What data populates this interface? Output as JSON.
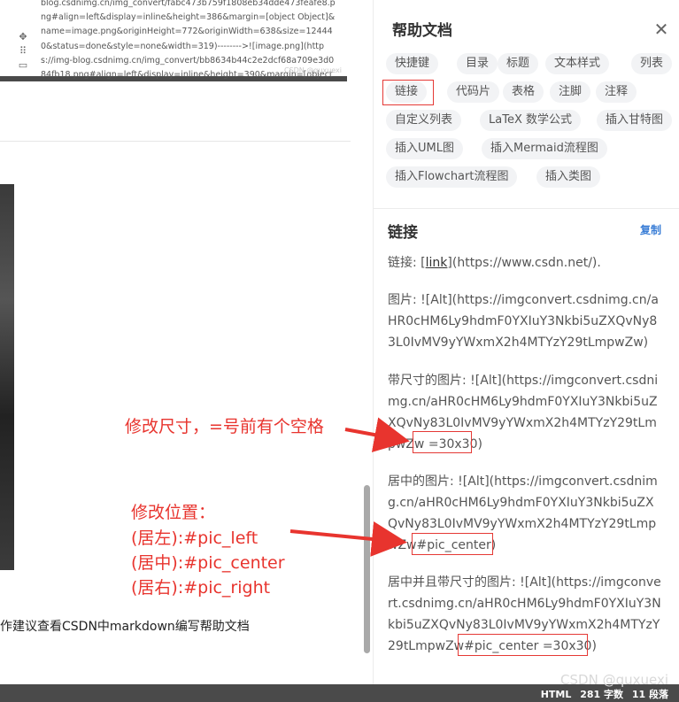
{
  "editor": {
    "code_lines": "blog.csdnimg.cn/img_convert/fabc473b759f1808eb34dde473feafe8.png#align=left&display=inline&height=386&margin=[object Object]&name=image.png&originHeight=772&originWidth=638&size=124440&status=done&style=none&width=319)-------->![image.png](https://img-blog.csdnimg.cn/img_convert/bb8634b44c2e2dcf68a709e3d084fb18.png#align=left&display=inline&height=390&margin=[object",
    "code_watermark": "CSDN @quxuexi",
    "bottom_text": "作建议查看CSDN中markdown编写帮助文档"
  },
  "annotations": {
    "size_note": "修改尺寸，=号前有个空格",
    "position_note_title": "修改位置：",
    "position_left": "(居左):#pic_left",
    "position_center": "(居中):#pic_center",
    "position_right": "(居右):#pic_right",
    "color": "#e8342e"
  },
  "help_panel": {
    "title": "帮助文档",
    "close_icon": "close-icon",
    "tags": [
      "快捷键",
      "目录",
      "标题",
      "文本样式",
      "列表",
      "链接",
      "代码片",
      "表格",
      "注脚",
      "注释",
      "自定义列表",
      "LaTeX 数学公式",
      "插入甘特图",
      "插入UML图",
      "插入Mermaid流程图",
      "插入Flowchart流程图",
      "插入类图"
    ],
    "active_tag": "链接",
    "section_title": "链接",
    "copy_label": "复制",
    "link_prefix": "链接: [",
    "link_text": "link",
    "link_suffix": "](https://www.csdn.net/).",
    "image_line": "图片: ![Alt](https://imgconvert.csdnimg.cn/aHR0cHM6Ly9hdmF0YXIuY3Nkbi5uZXQvNy83L0IvMV9yYWxmX2h4MTYzY29tLmpwZw)",
    "sized_prefix": "带尺寸的图片: ![Alt](https://imgconvert.csdnimg.cn/aHR0cHM6Ly9hdmF0YXIuY3Nkbi5uZXQvNy83L0IvMV9yYWxmX2h4MTYzY29tLmpwZw",
    "sized_suffix": " =30x30)",
    "center_prefix": "居中的图片: ![Alt](https://imgconvert.csdnimg.cn/aHR0cHM6Ly9hdmF0YXIuY3Nkbi5uZXQvNy83L0IvMV9yYWxmX2h4MTYzY29tLmpwZw",
    "center_suffix": "#pic_center)",
    "center_sized_prefix": "居中并且带尺寸的图片: ![Alt](https://imgconvert.csdnimg.cn/aHR0cHM6Ly9hdmF0YXIuY3Nkbi5uZXQvNy83L0IvMV9yYWxmX2h4MTYzY29tLmpwZw",
    "center_sized_suffix": "#pic_center =30x30)"
  },
  "status_bar": {
    "mode": "HTML",
    "word_count": "281 字数",
    "paragraph_count": "11 段落"
  },
  "watermark": "CSDN @quxuexi"
}
